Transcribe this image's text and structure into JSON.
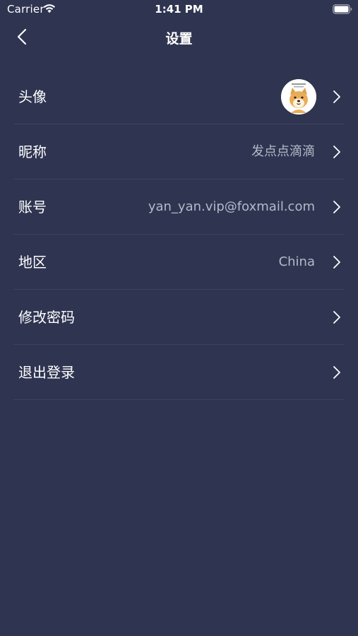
{
  "status_bar": {
    "carrier": "Carrier",
    "time": "1:41 PM",
    "wifi_icon": "wifi-icon",
    "battery_icon": "battery-icon"
  },
  "nav": {
    "title": "设置",
    "back_icon": "chevron-left-icon"
  },
  "settings": {
    "items": [
      {
        "label": "头像",
        "value": "",
        "type": "avatar"
      },
      {
        "label": "昵称",
        "value": "发点点滴滴"
      },
      {
        "label": "账号",
        "value": "yan_yan.vip@foxmail.com"
      },
      {
        "label": "地区",
        "value": "China"
      },
      {
        "label": "修改密码",
        "value": ""
      },
      {
        "label": "退出登录",
        "value": ""
      }
    ]
  },
  "colors": {
    "background": "#2f3551",
    "divider": "#3b4260",
    "value_text": "#b4b9c9",
    "primary_text": "#ffffff"
  }
}
